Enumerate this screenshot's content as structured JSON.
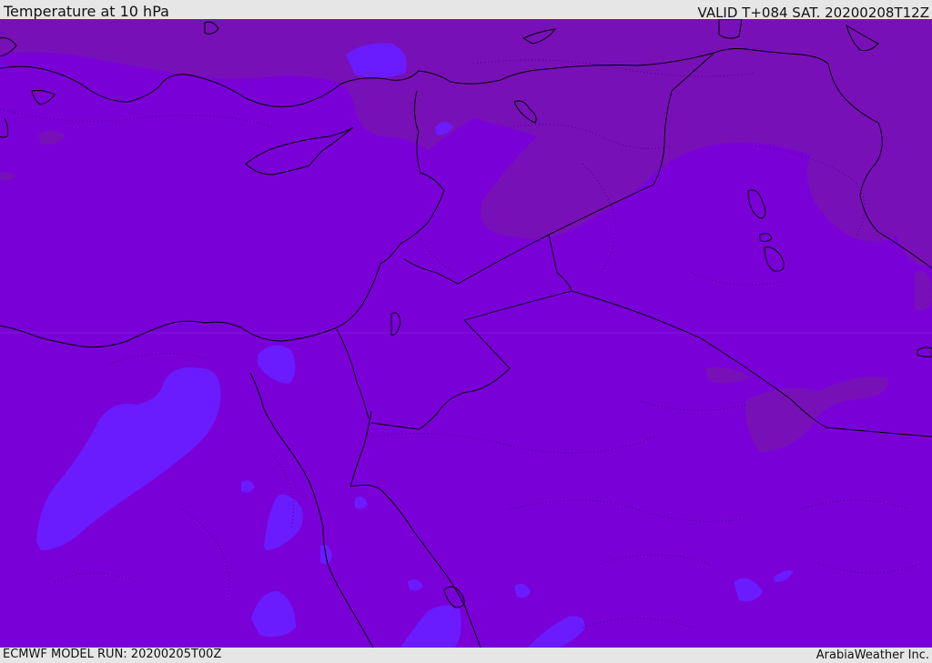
{
  "header": {
    "title": "Temperature at 10 hPa",
    "valid": "VALID T+084 SAT. 20200208T12Z"
  },
  "footer": {
    "model_run": "ECMWF MODEL RUN: 20200205T00Z",
    "credit": "ArabiaWeather Inc."
  },
  "map": {
    "colors": {
      "base": "#7a00d8",
      "cold_region": "#7810b8",
      "warm_region": "#6a1cff",
      "coastline": "#000000",
      "contour": "#3a0070"
    },
    "layers": [
      "temperature-field",
      "coastlines",
      "country-borders",
      "dotted-contours"
    ]
  }
}
